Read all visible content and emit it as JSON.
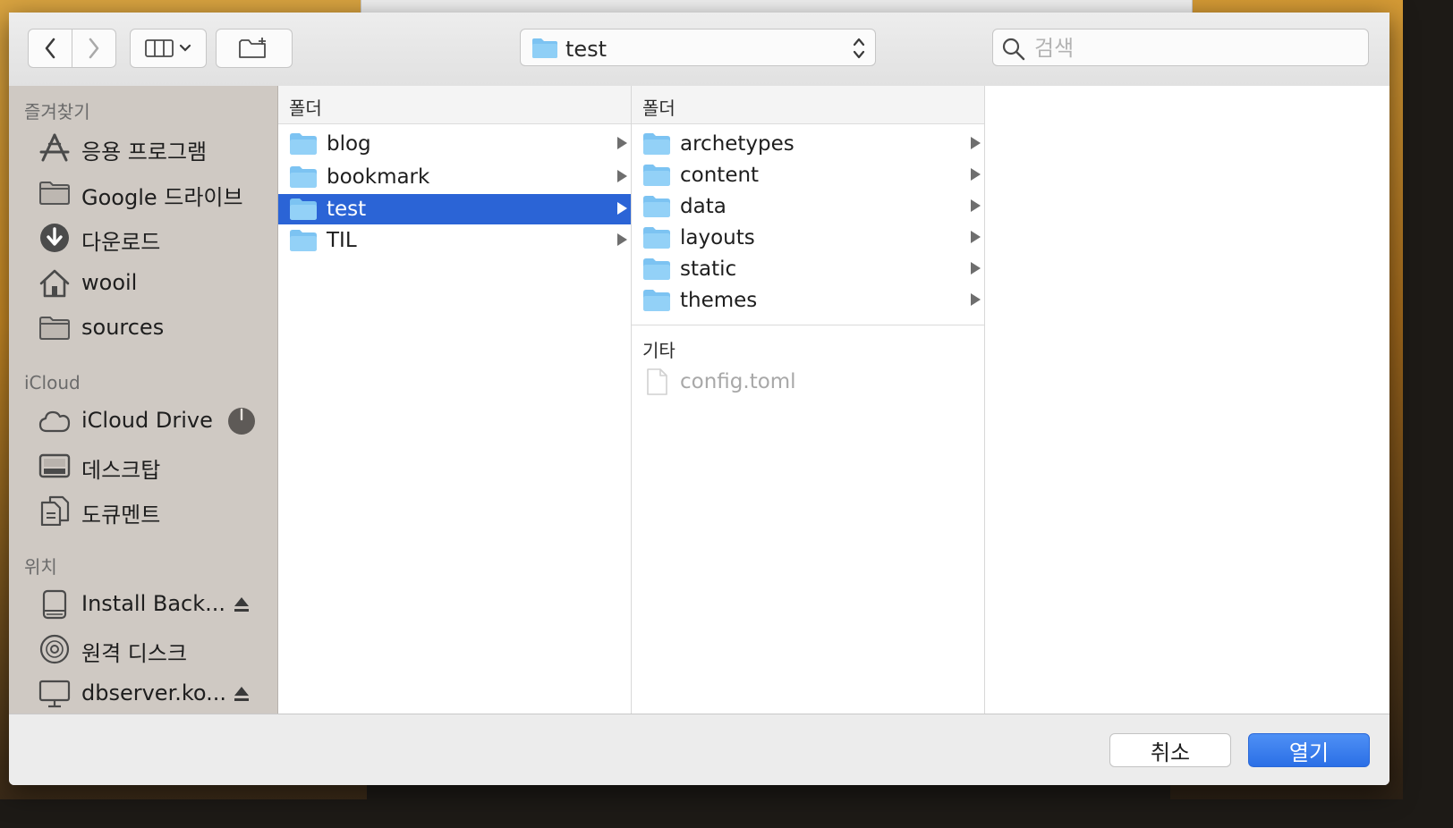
{
  "toolbar": {
    "path_label": "test",
    "search_placeholder": "검색"
  },
  "sidebar": {
    "sections": [
      {
        "title": "즐겨찾기",
        "items": [
          {
            "label": "응용 프로그램",
            "icon": "applications-icon"
          },
          {
            "label": "Google 드라이브",
            "icon": "folder-icon"
          },
          {
            "label": "다운로드",
            "icon": "download-icon"
          },
          {
            "label": "wooil",
            "icon": "home-icon"
          },
          {
            "label": "sources",
            "icon": "folder-icon"
          }
        ]
      },
      {
        "title": "iCloud",
        "items": [
          {
            "label": "iCloud Drive",
            "icon": "cloud-icon",
            "trailing": "sync-progress-icon"
          },
          {
            "label": "데스크탑",
            "icon": "desktop-icon"
          },
          {
            "label": "도큐멘트",
            "icon": "documents-icon"
          }
        ]
      },
      {
        "title": "위치",
        "items": [
          {
            "label": "Install Back...",
            "icon": "disk-icon",
            "trailing": "eject-icon"
          },
          {
            "label": "원격 디스크",
            "icon": "optical-disc-icon"
          },
          {
            "label": "dbserver.ko...",
            "icon": "monitor-icon",
            "trailing": "eject-icon"
          }
        ]
      }
    ]
  },
  "columns": [
    {
      "header": "폴더",
      "items": [
        "blog",
        "bookmark",
        "test",
        "TIL"
      ],
      "selected": "test"
    },
    {
      "header": "폴더",
      "items": [
        "archetypes",
        "content",
        "data",
        "layouts",
        "static",
        "themes"
      ],
      "other_header": "기타",
      "files": [
        "config.toml"
      ]
    }
  ],
  "buttons": {
    "cancel": "취소",
    "open": "열기"
  },
  "colors": {
    "selection": "#2b64d6",
    "folder": "#7cc3f2",
    "primary_button": "#2b6fe6"
  }
}
